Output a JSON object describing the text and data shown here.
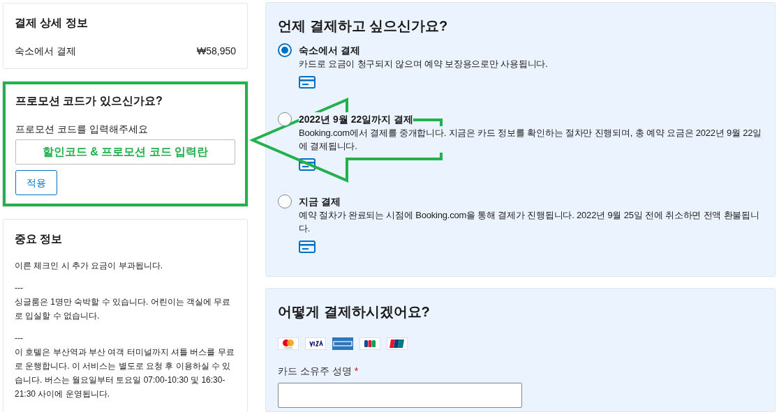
{
  "payment_details": {
    "title": "결제 상세 정보",
    "rows": [
      {
        "label": "숙소에서 결제",
        "value": "₩58,950"
      }
    ]
  },
  "promo": {
    "title": "프로모션 코드가 있으신가요?",
    "label": "프로모션 코드를 입력해주세요",
    "value": "할인코드 & 프로모션 코드 입력란",
    "button": "적용",
    "highlighted": true
  },
  "important_info": {
    "title": "중요 정보",
    "paragraphs": [
      {
        "kind": "text",
        "text": "이른 체크인 시 추가 요금이 부과됩니다."
      },
      {
        "kind": "separator",
        "text": "---"
      },
      {
        "kind": "text",
        "text": "싱글룸은 1명만 숙박할 수 있습니다. 어린이는 객실에 무료로 입실할 수 없습니다."
      },
      {
        "kind": "separator",
        "text": "---"
      },
      {
        "kind": "text",
        "text": "이 호텔은 부산역과 부산 여객 터미널까지 셔틀 버스를 무료로 운행합니다. 이 서비스는 별도로 요청 후 이용하실 수 있습니다. 버스는 월요일부터 토요일 07:00-10:30 및 16:30-21:30 사이에 운영됩니다."
      }
    ]
  },
  "when_to_pay": {
    "title": "언제 결제하고 싶으신가요?",
    "options": [
      {
        "title": "숙소에서 결제",
        "description": "카드로 요금이 청구되지 않으며 예약 보장용으로만 사용됩니다.",
        "selected": true
      },
      {
        "title": "2022년 9월 22일까지 결제",
        "description": "Booking.com에서 결제를 중개합니다. 지금은 카드 정보를 확인하는 절차만 진행되며, 총 예약 요금은 2022년 9월 22일에 결제됩니다.",
        "selected": false
      },
      {
        "title": "지금 결제",
        "description": "예약 절차가 완료되는 시점에 Booking.com을 통해 결제가 진행됩니다. 2022년 9월 25일 전에 취소하면 전액 환불됩니다.",
        "selected": false
      }
    ]
  },
  "how_to_pay": {
    "title": "어떻게 결제하시겠어요?",
    "field_label": "카드 소유주 성명",
    "required": true,
    "required_mark": "*"
  }
}
